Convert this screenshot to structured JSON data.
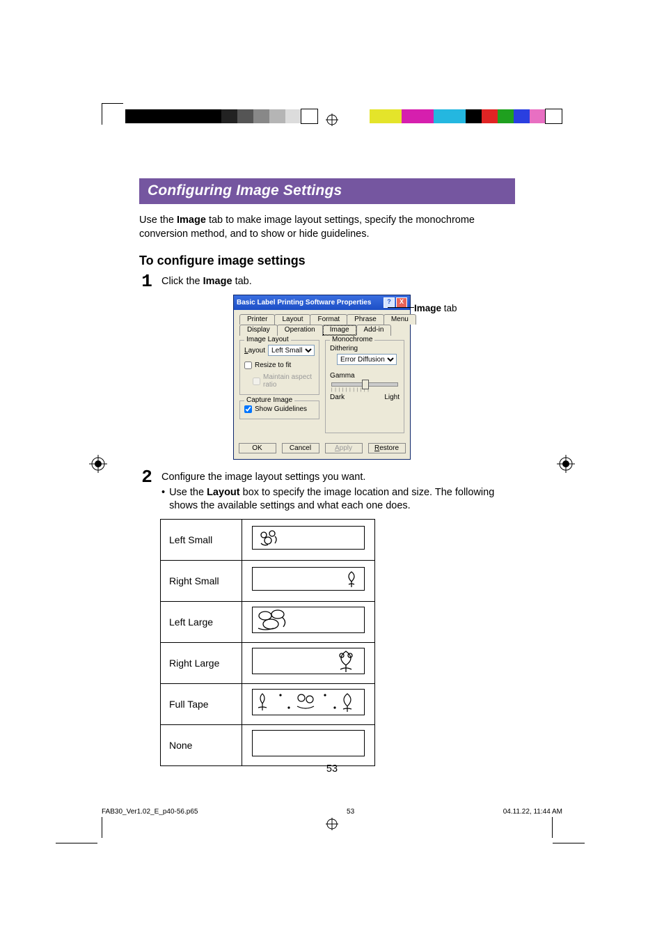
{
  "colorbars": {
    "left_colors": [
      "#000000",
      "#000000",
      "#000000",
      "#000000",
      "#000000",
      "#000000",
      "#222222",
      "#555555",
      "#888888",
      "#b5b5b5",
      "#dcdcdc",
      "#ffffff"
    ],
    "right_colors": [
      "#e4e42a",
      "#e4e42a",
      "#d61fae",
      "#d61fae",
      "#24b7e0",
      "#24b7e0",
      "#000000",
      "#e02424",
      "#1fa01f",
      "#2a3fe0",
      "#e86fc2",
      "#ffffff"
    ]
  },
  "heading": "Configuring Image Settings",
  "intro_pre": "Use the ",
  "intro_bold": "Image",
  "intro_post": " tab to make image layout settings, specify the monochrome conversion method, and to show or hide guidelines.",
  "subheading": "To configure image settings",
  "step1_num": "1",
  "step1_pre": "Click the ",
  "step1_bold": "Image",
  "step1_post": " tab.",
  "step2_num": "2",
  "step2_line1": "Configure the image layout settings you want.",
  "step2_bullet_pre": "Use the ",
  "step2_bullet_bold": "Layout",
  "step2_bullet_post": " box to specify the image location and size. The following shows the available settings and what each one does.",
  "callout_bold": "Image",
  "callout_post": " tab",
  "dialog": {
    "title": "Basic Label Printing Software Properties",
    "help_glyph": "?",
    "close_glyph": "X",
    "tabs_row1": [
      "Printer",
      "Layout",
      "Format",
      "Phrase",
      "Menu"
    ],
    "tabs_row2": [
      "Display",
      "Operation",
      "Image",
      "Add-in"
    ],
    "selected_tab_index_row2": 2,
    "groups": {
      "image_layout": {
        "legend": "Image Layout",
        "layout_label": "Layout",
        "layout_value": "Left Small",
        "resize": "Resize to fit",
        "maintain": "Maintain aspect ratio"
      },
      "capture": {
        "legend": "Capture Image",
        "show_guidelines": "Show Guidelines"
      },
      "monochrome": {
        "legend": "Monochrome",
        "dithering_label": "Dithering",
        "dithering_value": "Error Diffusion",
        "gamma_label": "Gamma",
        "dark": "Dark",
        "light": "Light"
      }
    },
    "buttons": {
      "ok": "OK",
      "cancel": "Cancel",
      "apply": "Apply",
      "restore": "Restore"
    }
  },
  "layout_options": [
    "Left Small",
    "Right Small",
    "Left Large",
    "Right Large",
    "Full Tape",
    "None"
  ],
  "page_number": "53",
  "footer": {
    "file": "FAB30_Ver1.02_E_p40-56.p65",
    "page": "53",
    "timestamp": "04.11.22, 11:44 AM"
  }
}
